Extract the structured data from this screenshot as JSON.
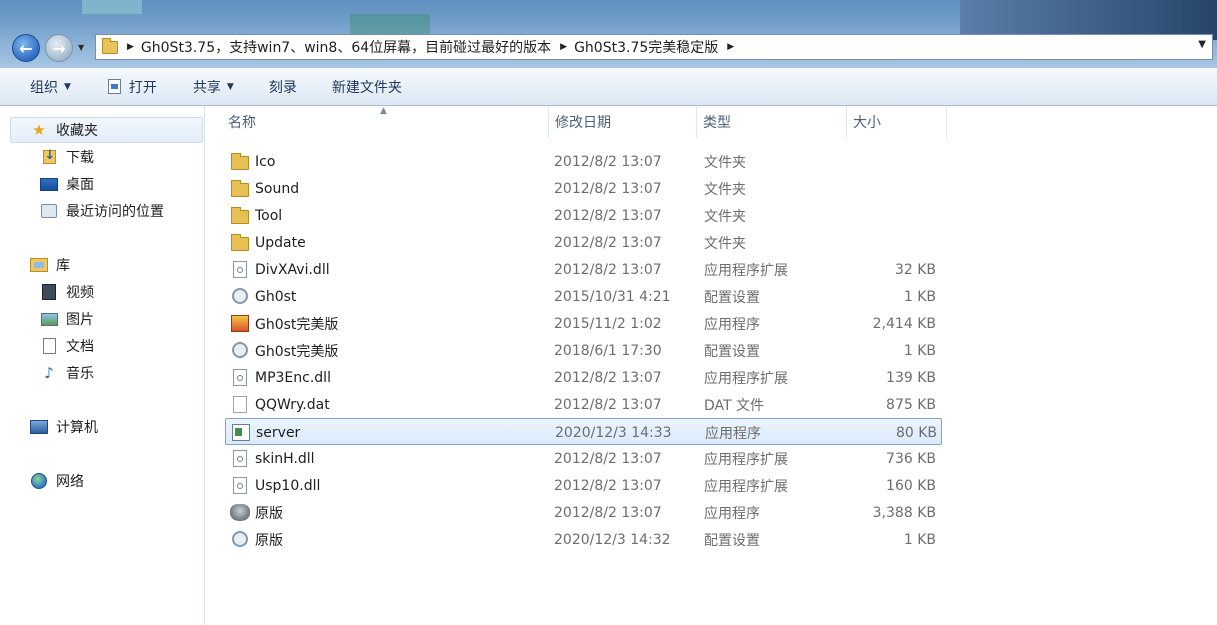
{
  "address": {
    "crumbs": [
      "Gh0St3.75，支持win7、win8、64位屏幕，目前碰过最好的版本",
      "Gh0St3.75完美稳定版"
    ]
  },
  "toolbar": {
    "organize": "组织",
    "open": "打开",
    "share": "共享",
    "burn": "刻录",
    "new_folder": "新建文件夹"
  },
  "nav": {
    "favorites": "收藏夹",
    "downloads": "下载",
    "desktop": "桌面",
    "recent": "最近访问的位置",
    "libraries": "库",
    "videos": "视频",
    "pictures": "图片",
    "documents": "文档",
    "music": "音乐",
    "computer": "计算机",
    "network": "网络"
  },
  "columns": {
    "name": "名称",
    "date": "修改日期",
    "type": "类型",
    "size": "大小"
  },
  "files": [
    {
      "name": "Ico",
      "date": "2012/8/2 13:07",
      "type": "文件夹",
      "size": "",
      "icon": "folder-icon"
    },
    {
      "name": "Sound",
      "date": "2012/8/2 13:07",
      "type": "文件夹",
      "size": "",
      "icon": "folder-icon"
    },
    {
      "name": "Tool",
      "date": "2012/8/2 13:07",
      "type": "文件夹",
      "size": "",
      "icon": "folder-icon"
    },
    {
      "name": "Update",
      "date": "2012/8/2 13:07",
      "type": "文件夹",
      "size": "",
      "icon": "folder-icon"
    },
    {
      "name": "DivXAvi.dll",
      "date": "2012/8/2 13:07",
      "type": "应用程序扩展",
      "size": "32 KB",
      "icon": "dll-icon"
    },
    {
      "name": "Gh0st",
      "date": "2015/10/31 4:21",
      "type": "配置设置",
      "size": "1 KB",
      "icon": "config-icon"
    },
    {
      "name": "Gh0st完美版",
      "date": "2015/11/2 1:02",
      "type": "应用程序",
      "size": "2,414 KB",
      "icon": "app-icon"
    },
    {
      "name": "Gh0st完美版",
      "date": "2018/6/1 17:30",
      "type": "配置设置",
      "size": "1 KB",
      "icon": "config-icon"
    },
    {
      "name": "MP3Enc.dll",
      "date": "2012/8/2 13:07",
      "type": "应用程序扩展",
      "size": "139 KB",
      "icon": "dll-icon"
    },
    {
      "name": "QQWry.dat",
      "date": "2012/8/2 13:07",
      "type": "DAT 文件",
      "size": "875 KB",
      "icon": "file-icon"
    },
    {
      "name": "server",
      "date": "2020/12/3 14:33",
      "type": "应用程序",
      "size": "80 KB",
      "icon": "exe-icon"
    },
    {
      "name": "skinH.dll",
      "date": "2012/8/2 13:07",
      "type": "应用程序扩展",
      "size": "736 KB",
      "icon": "dll-icon"
    },
    {
      "name": "Usp10.dll",
      "date": "2012/8/2 13:07",
      "type": "应用程序扩展",
      "size": "160 KB",
      "icon": "dll-icon"
    },
    {
      "name": "原版",
      "date": "2012/8/2 13:07",
      "type": "应用程序",
      "size": "3,388 KB",
      "icon": "ram-icon"
    },
    {
      "name": "原版",
      "date": "2020/12/3 14:32",
      "type": "配置设置",
      "size": "1 KB",
      "icon": "config-icon"
    }
  ],
  "selected_file": "server"
}
